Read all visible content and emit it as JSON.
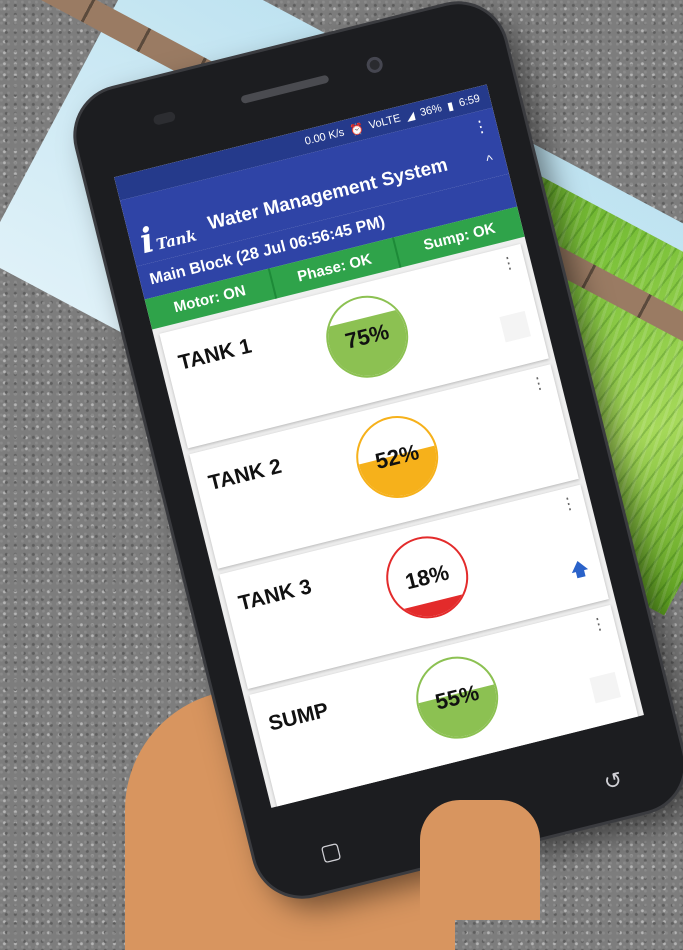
{
  "statusbar": {
    "speed": "0.00 K/s",
    "network": "VoLTE",
    "battery": "36%",
    "time": "6:59"
  },
  "app": {
    "logo_i": "i",
    "logo_tank": "Tank",
    "title": "Water Management System",
    "menu_icon": "⋮",
    "collapse_icon": "^"
  },
  "block": {
    "title": "Main Block (28 Jul 06:56:45 PM)",
    "status": [
      "Motor: ON",
      "Phase: OK",
      "Sump: OK"
    ]
  },
  "tanks": [
    {
      "name": "TANK 1",
      "level_pct": 75,
      "label": "75%",
      "color": "#8cc152"
    },
    {
      "name": "TANK 2",
      "level_pct": 52,
      "label": "52%",
      "color": "#f6b11b"
    },
    {
      "name": "TANK 3",
      "level_pct": 18,
      "label": "18%",
      "color": "#e32b2b"
    },
    {
      "name": "SUMP",
      "level_pct": 55,
      "label": "55%",
      "color": "#8cc152"
    }
  ],
  "colors": {
    "appbar": "#2f44a6",
    "statusrow": "#2fa34a",
    "up_arrow": "#2a62c9"
  }
}
